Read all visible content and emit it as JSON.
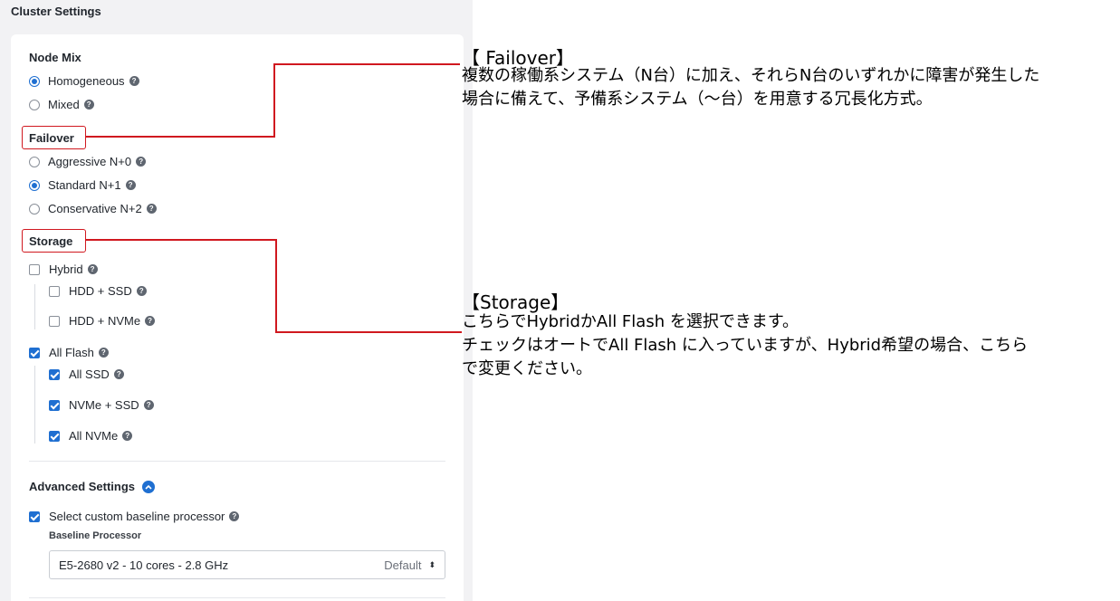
{
  "panel": {
    "title": "Cluster Settings",
    "node_mix": {
      "heading": "Node Mix",
      "options": [
        {
          "label": "Homogeneous",
          "selected": true
        },
        {
          "label": "Mixed",
          "selected": false
        }
      ]
    },
    "failover": {
      "heading": "Failover",
      "options": [
        {
          "label": "Aggressive N+0",
          "selected": false
        },
        {
          "label": "Standard N+1",
          "selected": true
        },
        {
          "label": "Conservative N+2",
          "selected": false
        }
      ]
    },
    "storage": {
      "heading": "Storage",
      "hybrid": {
        "label": "Hybrid",
        "checked": false
      },
      "hybrid_options": [
        {
          "label": "HDD + SSD",
          "checked": false
        },
        {
          "label": "HDD + NVMe",
          "checked": false
        }
      ],
      "all_flash": {
        "label": "All Flash",
        "checked": true
      },
      "flash_options": [
        {
          "label": "All SSD",
          "checked": true
        },
        {
          "label": "NVMe + SSD",
          "checked": true
        },
        {
          "label": "All NVMe",
          "checked": true
        }
      ]
    },
    "advanced": {
      "heading": "Advanced Settings",
      "custom_processor": {
        "label": "Select custom baseline processor",
        "checked": true
      },
      "processor_label": "Baseline Processor",
      "processor_value": "E5-2680 v2 - 10 cores - 2.8 GHz",
      "processor_default": "Default"
    }
  },
  "annotations": {
    "failover": {
      "title": "【 Failover】",
      "lines": [
        "複数の稼働系システム（N台）に加え、それらN台のいずれかに障害が発生した",
        "場合に備えて、予備系システム（～台）を用意する冗長化方式。"
      ]
    },
    "storage": {
      "title": "【Storage】",
      "lines": [
        "こちらでHybridかAll Flash を選択できます。",
        "チェックはオートでAll Flash に入っていますが、Hybrid希望の場合、こちら",
        "で変更ください。"
      ]
    }
  },
  "colors": {
    "accent": "#1f6fd1",
    "annotation_red": "#d0181f",
    "pane_bg": "#f2f2f4"
  },
  "icons": {
    "help": "question-circle-icon",
    "collapse": "chevron-up-icon",
    "select_arrows": "up-down-arrows-icon"
  }
}
